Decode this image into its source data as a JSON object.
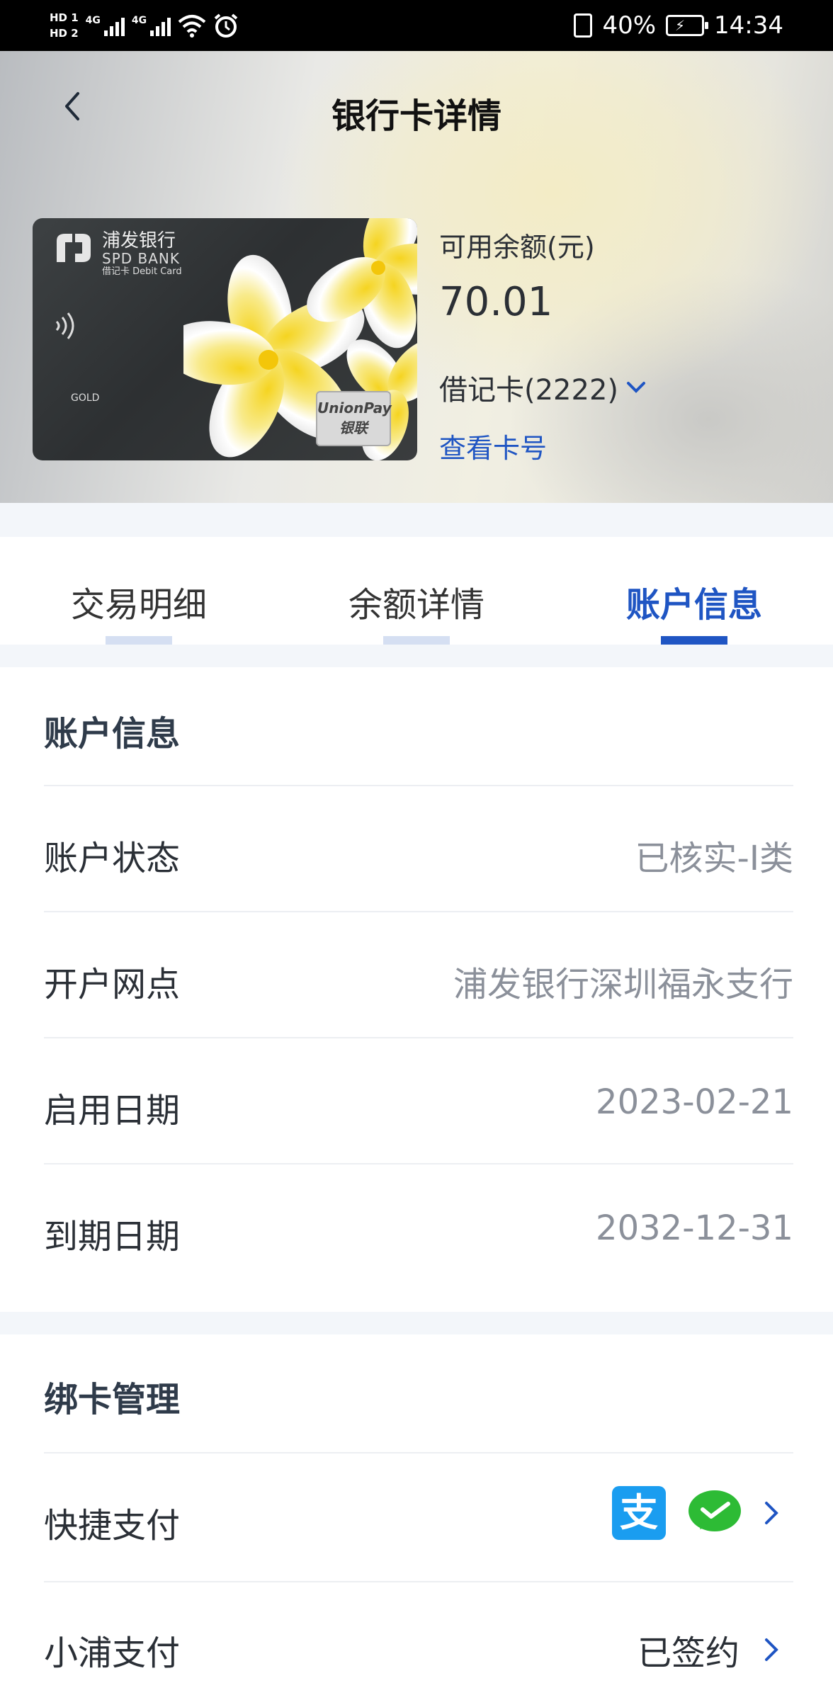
{
  "status_bar": {
    "hd1": "HD 1",
    "hd2": "HD 2",
    "net1": "4G",
    "net2": "4G",
    "battery": "40%",
    "time": "14:34"
  },
  "header": {
    "title": "银行卡详情"
  },
  "card": {
    "bank_cn": "浦发银行",
    "bank_en": "SPD BANK",
    "card_type": "借记卡 Debit Card",
    "tier": "GOLD",
    "unionpay_en": "UnionPay",
    "unionpay_cn": "银联"
  },
  "balance": {
    "label": "可用余额(元)",
    "value": "70.01",
    "card_select": "借记卡(2222)",
    "view_number": "查看卡号"
  },
  "tabs": [
    {
      "label": "交易明细",
      "active": false
    },
    {
      "label": "余额详情",
      "active": false
    },
    {
      "label": "账户信息",
      "active": true
    }
  ],
  "account_info": {
    "title": "账户信息",
    "rows": [
      {
        "label": "账户状态",
        "value": "已核实-I类"
      },
      {
        "label": "开户网点",
        "value": "浦发银行深圳福永支行"
      },
      {
        "label": "启用日期",
        "value": "2023-02-21"
      },
      {
        "label": "到期日期",
        "value": "2032-12-31"
      }
    ]
  },
  "binding": {
    "title": "绑卡管理",
    "quick_pay": {
      "label": "快捷支付",
      "alipay_glyph": "支"
    },
    "xiaopu_pay": {
      "label": "小浦支付",
      "value": "已签约"
    }
  },
  "colors": {
    "accent": "#1f55c3",
    "alipay": "#1a9df0",
    "wechat": "#2dbb35"
  }
}
